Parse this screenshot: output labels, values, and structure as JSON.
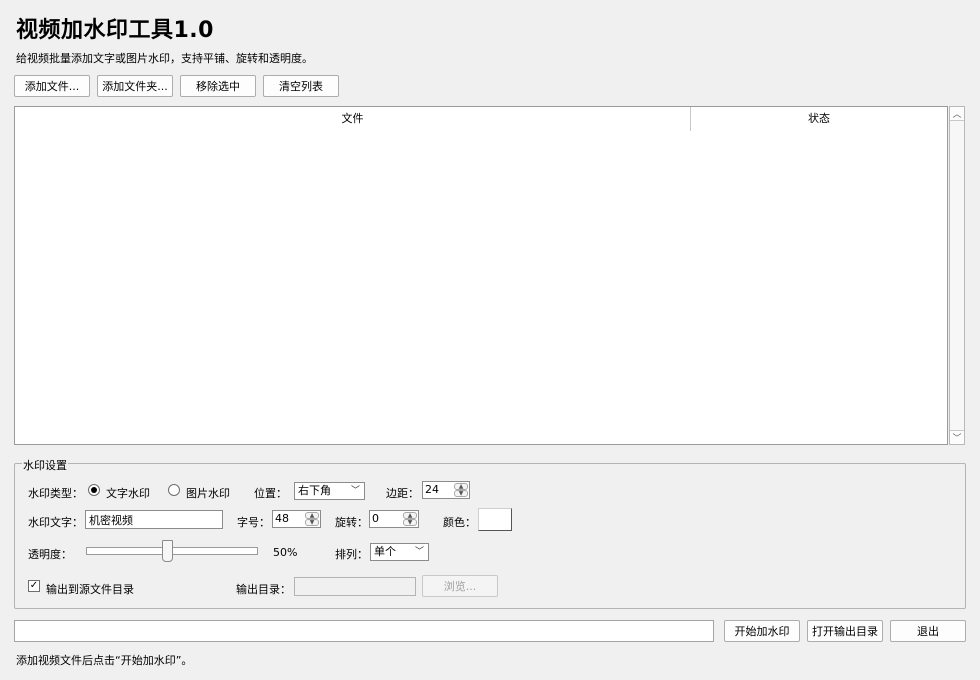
{
  "app": {
    "title": "视频加水印工具1.0",
    "subtitle": "给视频批量添加文字或图片水印，支持平铺、旋转和透明度。"
  },
  "toolbar": {
    "add_file": "添加文件...",
    "add_folder": "添加文件夹...",
    "remove_selected": "移除选中",
    "clear_list": "清空列表"
  },
  "file_table": {
    "columns": [
      "文件",
      "状态"
    ],
    "rows": []
  },
  "settings": {
    "group_title": "水印设置",
    "type_label": "水印类型：",
    "type_options": [
      "文字水印",
      "图片水印"
    ],
    "type_selected": "文字水印",
    "position_label": "位置：",
    "position_value": "右下角",
    "margin_label": "边距：",
    "margin_value": "24",
    "text_label": "水印文字：",
    "text_value": "机密视频",
    "font_size_label": "字号：",
    "font_size_value": "48",
    "rotation_label": "旋转：",
    "rotation_value": "0",
    "color_label": "颜色：",
    "color_value": "#ffffff",
    "opacity_label": "透明度：",
    "opacity_value": 0.5,
    "opacity_text": "50%",
    "layout_label": "排列：",
    "layout_value": "单个",
    "output_to_source_label": "输出到源文件目录",
    "output_to_source_checked": true,
    "output_dir_label": "输出目录：",
    "output_dir_value": "",
    "browse_label": "浏览..."
  },
  "actions": {
    "progress": 0,
    "start": "开始加水印",
    "open_output": "打开输出目录",
    "exit": "退出"
  },
  "status_text": "添加视频文件后点击“开始加水印”。"
}
